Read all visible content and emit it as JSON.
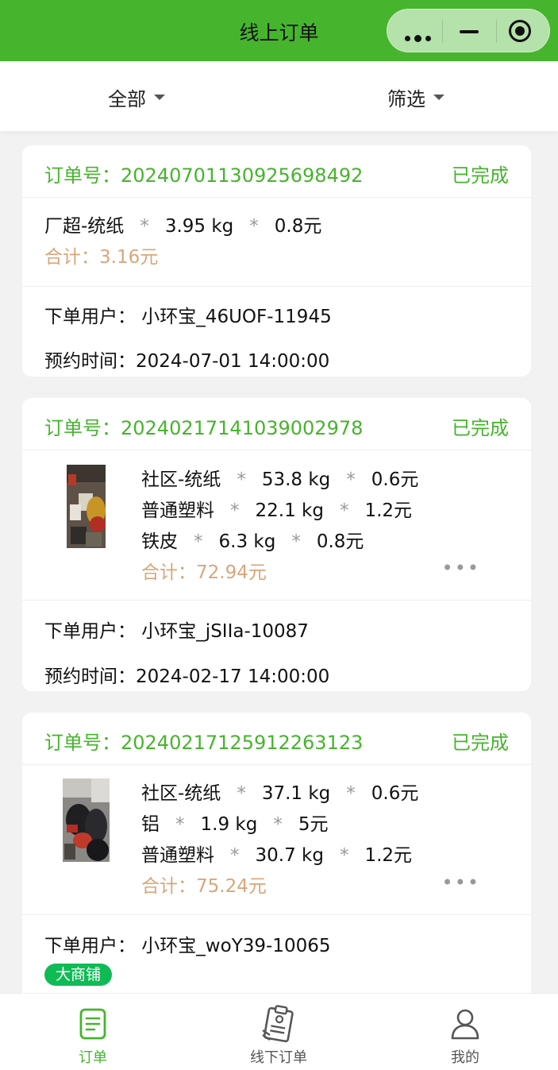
{
  "nav": {
    "title": "线上订单"
  },
  "filters": {
    "all_label": "全部",
    "filter_label": "筛选"
  },
  "orders": [
    {
      "order_no": "订单号：20240701130925698492",
      "status": "已完成",
      "items": [
        {
          "name": "厂超-统纸",
          "weight": "3.95 kg",
          "price": "0.8元"
        }
      ],
      "total": "合计：3.16元",
      "user": "下单用户：  小环宝_46UOF-11945",
      "time": "预约时间：2024-07-01 14:00:00"
    },
    {
      "order_no": "订单号：20240217141039002978",
      "status": "已完成",
      "items": [
        {
          "name": "社区-统纸",
          "weight": "53.8 kg",
          "price": "0.6元"
        },
        {
          "name": "普通塑料",
          "weight": "22.1 kg",
          "price": "1.2元"
        },
        {
          "name": "铁皮",
          "weight": "6.3 kg",
          "price": "0.8元"
        }
      ],
      "total": "合计：72.94元",
      "more": "•••",
      "user": "下单用户：  小环宝_jSIIa-10087",
      "time": "预约时间：2024-02-17 14:00:00"
    },
    {
      "order_no": "订单号：20240217125912263123",
      "status": "已完成",
      "items": [
        {
          "name": "社区-统纸",
          "weight": "37.1 kg",
          "price": "0.6元"
        },
        {
          "name": "铝",
          "weight": "1.9 kg",
          "price": "5元"
        },
        {
          "name": "普通塑料",
          "weight": "30.7 kg",
          "price": "1.2元"
        }
      ],
      "total": "合计：75.24元",
      "more": "•••",
      "user": "下单用户：  小环宝_woY39-10065",
      "tag": "大商铺"
    }
  ],
  "star": "*",
  "tabbar": [
    {
      "label": "订单",
      "icon": "document-icon",
      "active": true
    },
    {
      "label": "线下订单",
      "icon": "clipboard-icon",
      "active": false
    },
    {
      "label": "我的",
      "icon": "user-icon",
      "active": false
    }
  ],
  "colors": {
    "brand": "#46b42d",
    "total": "#d8a67a",
    "tag": "#0fbb55"
  }
}
